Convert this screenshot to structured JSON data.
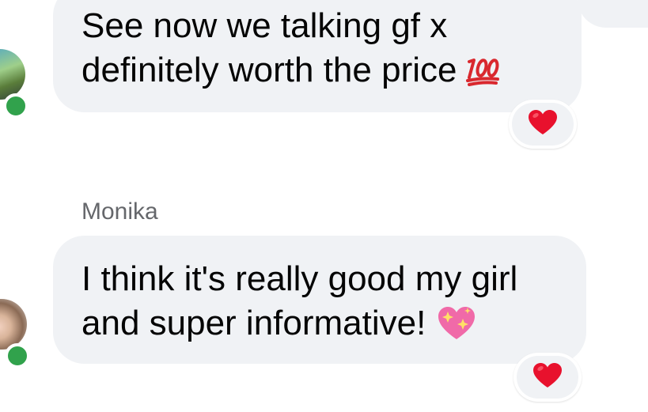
{
  "messages": [
    {
      "lines": [
        "See now we talking gf x",
        "definitely worth the price"
      ],
      "emoji": "hundred-points-icon",
      "reaction": "red-heart-icon",
      "online": true
    },
    {
      "sender": "Monika",
      "lines": [
        "I think it's really good my girl",
        "and super informative!"
      ],
      "emoji": "sparkling-heart-icon",
      "reaction": "red-heart-icon",
      "online": true
    }
  ],
  "colors": {
    "bubble": "#f0f2f5",
    "text": "#050505",
    "sender": "#65676b",
    "online": "#31a24c",
    "heart": "#e8112d",
    "emoji_100": "#d9282e",
    "sparkle_heart": "#f06aa8"
  }
}
